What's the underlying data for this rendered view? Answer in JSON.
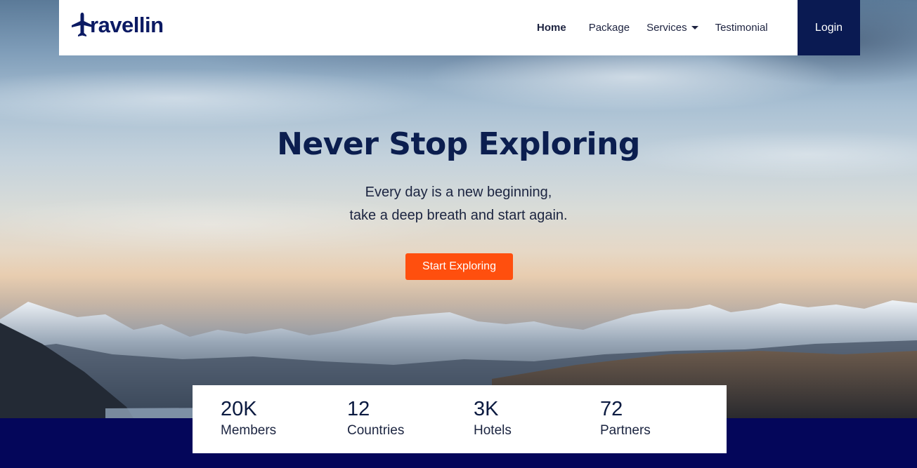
{
  "brand": {
    "name": "ravellin",
    "logo_icon": "airplane-icon",
    "color": "#0b1a63"
  },
  "nav": {
    "items": [
      {
        "label": "Home",
        "active": true
      },
      {
        "label": "Package"
      },
      {
        "label": "Services",
        "has_dropdown": true
      },
      {
        "label": "Testimonial"
      }
    ],
    "login_label": "Login"
  },
  "hero": {
    "title": "Never Stop Exploring",
    "subtitle_line1": "Every day is a new beginning,",
    "subtitle_line2": "take a deep breath and start again.",
    "cta_label": "Start Exploring"
  },
  "stats": [
    {
      "value": "20K",
      "label": "Members"
    },
    {
      "value": "12",
      "label": "Countries"
    },
    {
      "value": "3K",
      "label": "Hotels"
    },
    {
      "value": "72",
      "label": "Partners"
    }
  ],
  "colors": {
    "accent": "#ff4f0e",
    "navy": "#0a1a52",
    "footer_band": "#04065a"
  }
}
